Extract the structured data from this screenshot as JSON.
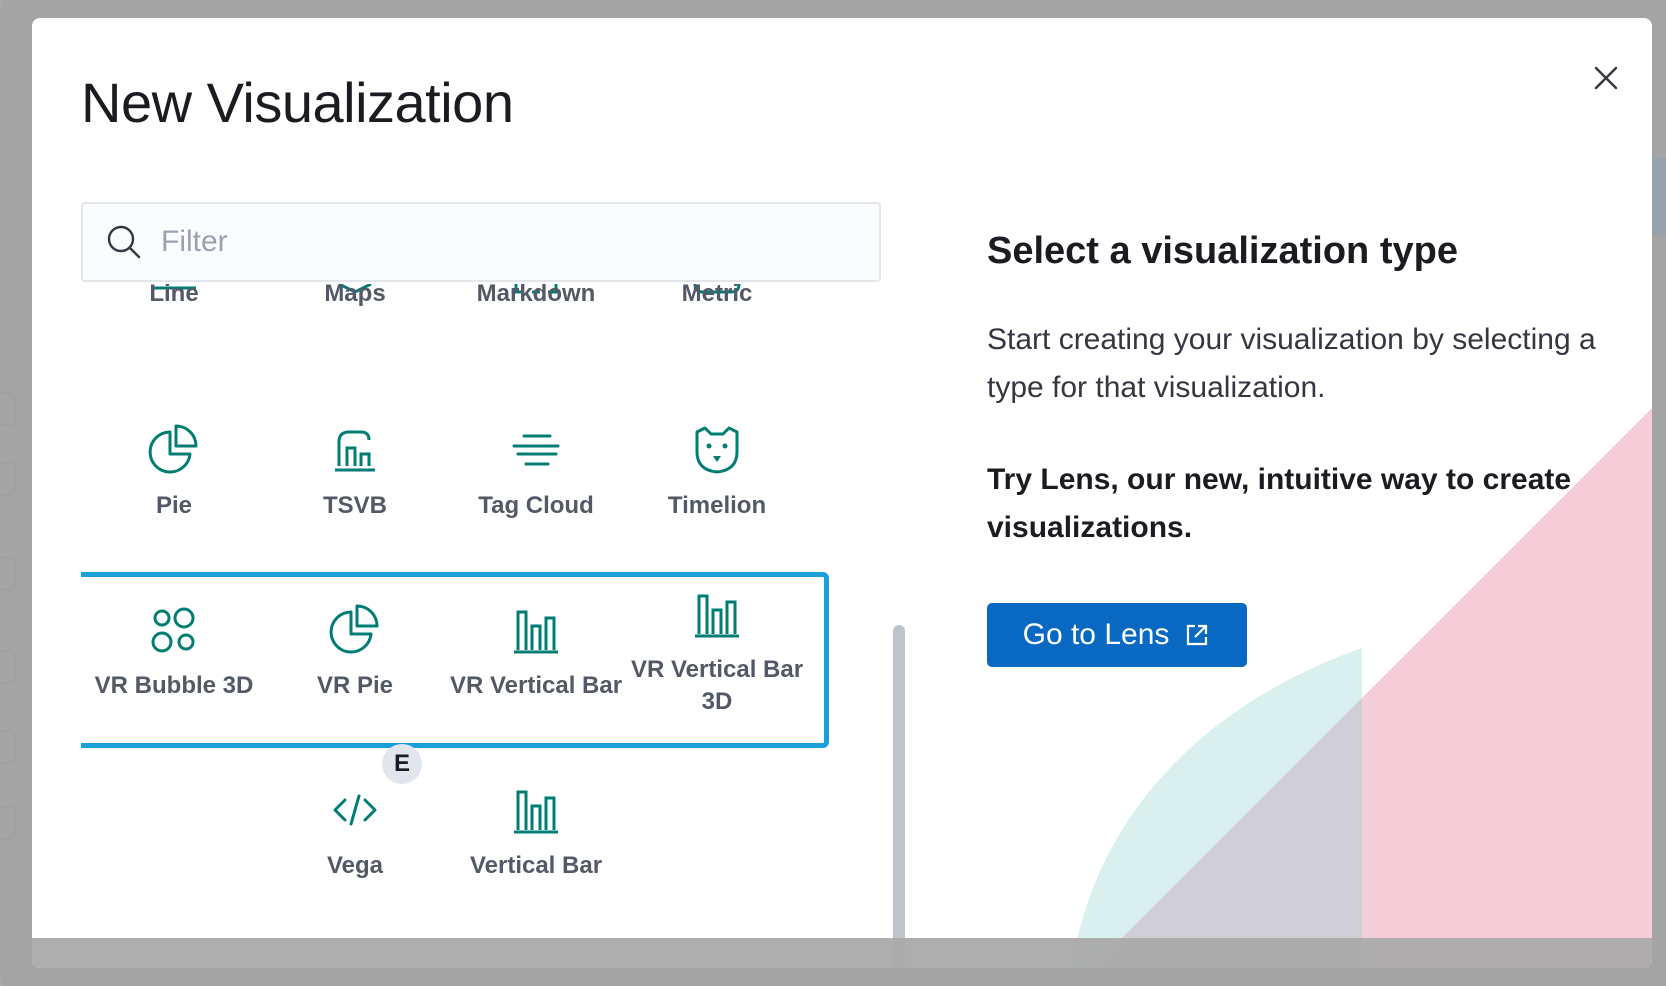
{
  "modal": {
    "title": "New Visualization",
    "close_label": "Close"
  },
  "filter": {
    "placeholder": "Filter",
    "value": ""
  },
  "visualizations": [
    {
      "label": "Line",
      "icon": "line-chart-icon"
    },
    {
      "label": "Maps",
      "icon": "maps-icon"
    },
    {
      "label": "Markdown",
      "icon": "markdown-icon"
    },
    {
      "label": "Metric",
      "icon": "metric-icon"
    },
    {
      "label": "Pie",
      "icon": "pie-chart-icon"
    },
    {
      "label": "TSVB",
      "icon": "tsvb-icon"
    },
    {
      "label": "Tag Cloud",
      "icon": "tag-cloud-icon"
    },
    {
      "label": "Timelion",
      "icon": "timelion-icon"
    },
    {
      "label": "VR Bubble 3D",
      "icon": "bubble-chart-icon"
    },
    {
      "label": "VR Pie",
      "icon": "pie-chart-icon"
    },
    {
      "label": "VR Vertical Bar",
      "icon": "vertical-bar-icon"
    },
    {
      "label": "VR Vertical Bar 3D",
      "icon": "vertical-bar-icon"
    },
    {
      "label": "Vega",
      "icon": "code-icon",
      "badge": "E"
    },
    {
      "label": "Vertical Bar",
      "icon": "vertical-bar-icon"
    }
  ],
  "right_panel": {
    "heading": "Select a visualization type",
    "description": "Start creating your visualization by selecting a type for that visualization.",
    "lens_prompt": "Try Lens, our new, intuitive way to create visualizations.",
    "lens_button": "Go to Lens"
  },
  "colors": {
    "icon": "#017d73",
    "highlight": "#1ba0dc",
    "button": "#0868c2"
  }
}
